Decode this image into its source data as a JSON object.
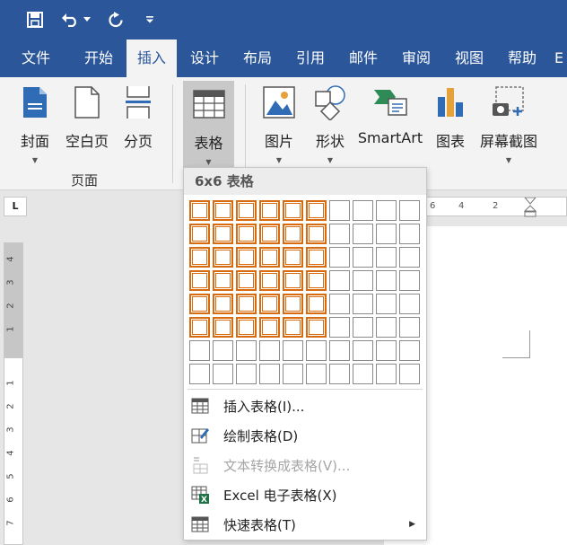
{
  "qat": {
    "save_icon": "save-icon",
    "undo_icon": "undo-icon",
    "redo_icon": "redo-icon",
    "customize_icon": "customize-arrow-icon"
  },
  "tabs": [
    {
      "label": "文件"
    },
    {
      "label": "开始"
    },
    {
      "label": "插入"
    },
    {
      "label": "设计"
    },
    {
      "label": "布局"
    },
    {
      "label": "引用"
    },
    {
      "label": "邮件"
    },
    {
      "label": "审阅"
    },
    {
      "label": "视图"
    },
    {
      "label": "帮助"
    },
    {
      "label": "E"
    }
  ],
  "ribbon": {
    "cover": "封面",
    "blank_page": "空白页",
    "page_break": "分页",
    "pages_group": "页面",
    "table": "表格",
    "pictures": "图片",
    "shapes": "形状",
    "smartart": "SmartArt",
    "chart": "图表",
    "screenshot": "屏幕截图"
  },
  "ruler": {
    "corner": "L",
    "h_ticks": [
      "6",
      "4",
      "2"
    ],
    "v_ticks": [
      "4",
      "3",
      "2",
      "1",
      "1",
      "2",
      "3",
      "4",
      "5",
      "6",
      "7"
    ]
  },
  "dropdown": {
    "header": "6x6 表格",
    "grid": {
      "columns": 10,
      "rows": 8,
      "selected_columns": 6,
      "selected_rows": 6
    },
    "items": [
      {
        "label": "插入表格(I)...",
        "enabled": true
      },
      {
        "label": "绘制表格(D)",
        "enabled": true
      },
      {
        "label": "文本转换成表格(V)...",
        "enabled": false
      },
      {
        "label": "Excel 电子表格(X)",
        "enabled": true
      },
      {
        "label": "快速表格(T)",
        "enabled": true
      }
    ]
  },
  "colors": {
    "title_bar": "#2b579a",
    "selection": "#d86a10",
    "excel_green": "#1e7145"
  }
}
